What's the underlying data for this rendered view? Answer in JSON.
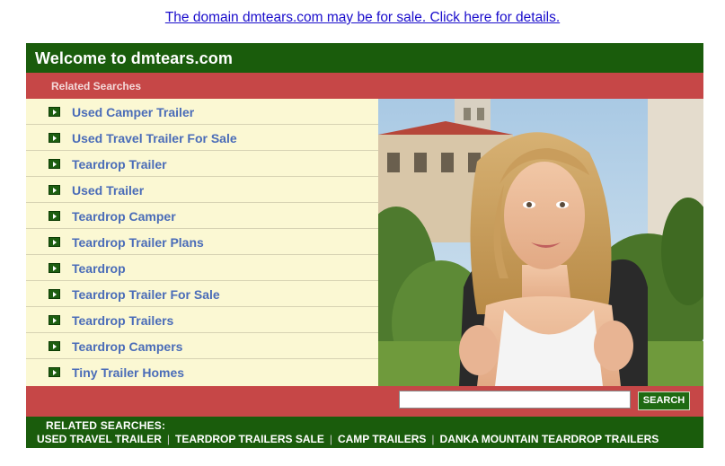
{
  "top_banner": {
    "text": "The domain dmtears.com may be for sale. Click here for details."
  },
  "header": {
    "title": "Welcome to dmtears.com"
  },
  "related_bar": {
    "label": "Related Searches"
  },
  "related_list": [
    {
      "label": "Used Camper Trailer"
    },
    {
      "label": "Used Travel Trailer For Sale"
    },
    {
      "label": "Teardrop Trailer"
    },
    {
      "label": "Used Trailer"
    },
    {
      "label": "Teardrop Camper"
    },
    {
      "label": "Teardrop Trailer Plans"
    },
    {
      "label": "Teardrop"
    },
    {
      "label": "Teardrop Trailer For Sale"
    },
    {
      "label": "Teardrop Trailers"
    },
    {
      "label": "Teardrop Campers"
    },
    {
      "label": "Tiny Trailer Homes"
    }
  ],
  "search": {
    "input_value": "",
    "button_label": "SEARCH"
  },
  "footer": {
    "label": "RELATED SEARCHES:",
    "links": [
      {
        "label": "USED TRAVEL TRAILER"
      },
      {
        "label": "TEARDROP TRAILERS SALE"
      },
      {
        "label": "CAMP TRAILERS"
      },
      {
        "label": "DANKA MOUNTAIN TEARDROP TRAILERS"
      }
    ]
  },
  "colors": {
    "header_green": "#1a5c0c",
    "related_red": "#c64747",
    "list_bg": "#fbf8d3",
    "link_blue": "#4a6cb8"
  }
}
